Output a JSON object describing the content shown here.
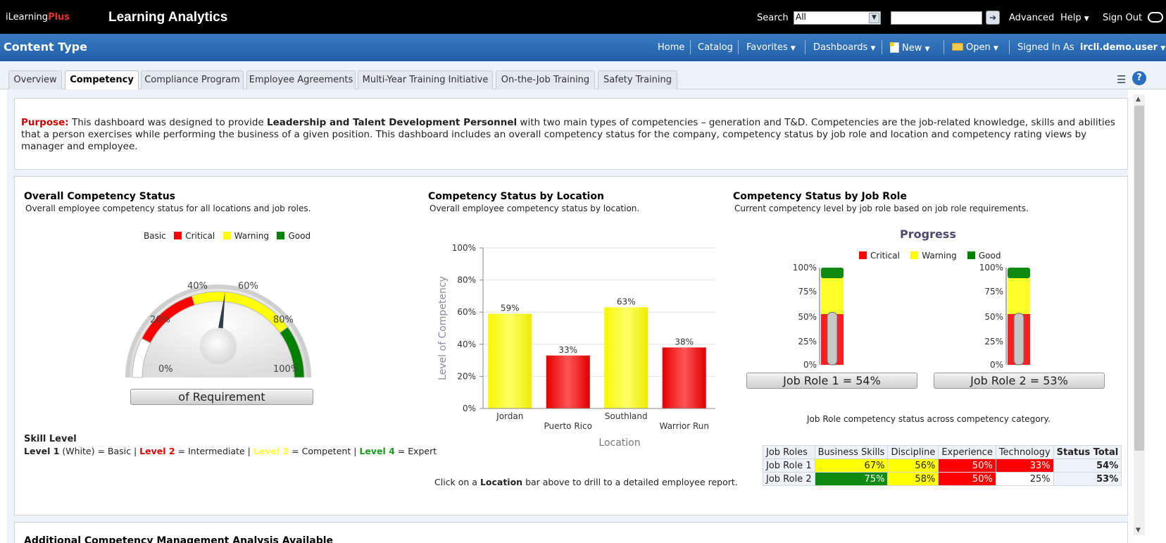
{
  "header": {
    "logo_prefix": "iLearning",
    "logo_suffix": "Plus",
    "app_title": "Learning Analytics",
    "search_label": "Search",
    "search_scope": "All",
    "search_value": "",
    "advanced": "Advanced",
    "help": "Help",
    "sign_out": "Sign Out"
  },
  "nav": {
    "page_title": "Content Type",
    "home": "Home",
    "catalog": "Catalog",
    "favorites": "Favorites",
    "dashboards": "Dashboards",
    "new": "New",
    "open": "Open",
    "signed_in_as": "Signed In As",
    "user": "ircli.demo.user"
  },
  "tabs": [
    {
      "label": "Overview"
    },
    {
      "label": "Competency"
    },
    {
      "label": "Compliance Program"
    },
    {
      "label": "Employee Agreements"
    },
    {
      "label": "Multi-Year Training Initiative"
    },
    {
      "label": "On-the-Job Training"
    },
    {
      "label": "Safety Training"
    }
  ],
  "purpose": {
    "label": "Purpose:",
    "text1": " This dashboard was designed to provide ",
    "bold1": "Leadership and Talent Development Personnel",
    "text2": " with two main types of competencies – generation and T&D. Competencies are the job-related knowledge, skills and abilities that a person exercises while performing the business of a given position. This dashboard includes an overall competency status for the company, competency status by job role and location and competency rating views by manager and employee."
  },
  "overall": {
    "title": "Overall Competency Status",
    "subtitle": "Overall employee competency status for all locations and job roles.",
    "legend": {
      "basic": "Basic",
      "critical": "Critical",
      "warning": "Warning",
      "good": "Good"
    },
    "gauge_ticks": [
      "0%",
      "20%",
      "40%",
      "60%",
      "80%",
      "100%"
    ],
    "gauge_value": 54,
    "gauge_caption": "of Requirement",
    "skill_title": "Skill Level",
    "skill_l1": "Level 1",
    "skill_l1_desc": " (White) = Basic | ",
    "skill_l2": "Level 2",
    "skill_l2_desc": " = Intermediate | ",
    "skill_l3": "Level 3",
    "skill_l3_desc": " = Competent | ",
    "skill_l4": "Level 4",
    "skill_l4_desc": " = Expert"
  },
  "location": {
    "title": "Competency Status by Location",
    "subtitle": "Overall employee competency status by location.",
    "footer_pre": "Click on a ",
    "footer_bold": "Location",
    "footer_post": " bar above to drill to a detailed employee report."
  },
  "jobrole": {
    "title": "Competency Status by Job Role",
    "subtitle": "Current competency level by job role based on job role requirements.",
    "chart_title": "Progress",
    "legend": {
      "critical": "Critical",
      "warning": "Warning",
      "good": "Good"
    },
    "ticks": [
      "100%",
      "75%",
      "50%",
      "25%",
      "0%"
    ],
    "thermometers": [
      {
        "label": "Job Role 1 = 54%",
        "value": 54
      },
      {
        "label": "Job Role 2 = 53%",
        "value": 53
      }
    ],
    "table_caption": "Job Role competency status across competency category.",
    "table_headers": [
      "Job Roles",
      "Business Skills",
      "Discipline",
      "Experience",
      "Technology",
      "Status Total"
    ],
    "table_rows": [
      {
        "cells": [
          "Job Role 1",
          "67%",
          "56%",
          "50%",
          "33%",
          "54%"
        ]
      },
      {
        "cells": [
          "Job Role 2",
          "75%",
          "58%",
          "50%",
          "25%",
          "53%"
        ]
      }
    ]
  },
  "additional_title": "Additional Competency Management Analysis Available",
  "colors": {
    "critical": "#ff0000",
    "warning": "#ffff00",
    "good": "#008000",
    "accent": "#1f5fa8"
  },
  "chart_data": {
    "type": "bar",
    "categories": [
      "Jordan",
      "Puerto Rico",
      "Southland",
      "Warrior Run"
    ],
    "values": [
      59,
      33,
      63,
      38
    ],
    "data_labels": [
      "59%",
      "33%",
      "63%",
      "38%"
    ],
    "bar_colors": [
      "#ffff00",
      "#ff0000",
      "#ffff00",
      "#ff0000"
    ],
    "xlabel": "Location",
    "ylabel": "Level of Competency",
    "ylim": [
      0,
      100
    ],
    "yticks": [
      "0%",
      "20%",
      "40%",
      "60%",
      "80%",
      "100%"
    ],
    "grid": true
  }
}
